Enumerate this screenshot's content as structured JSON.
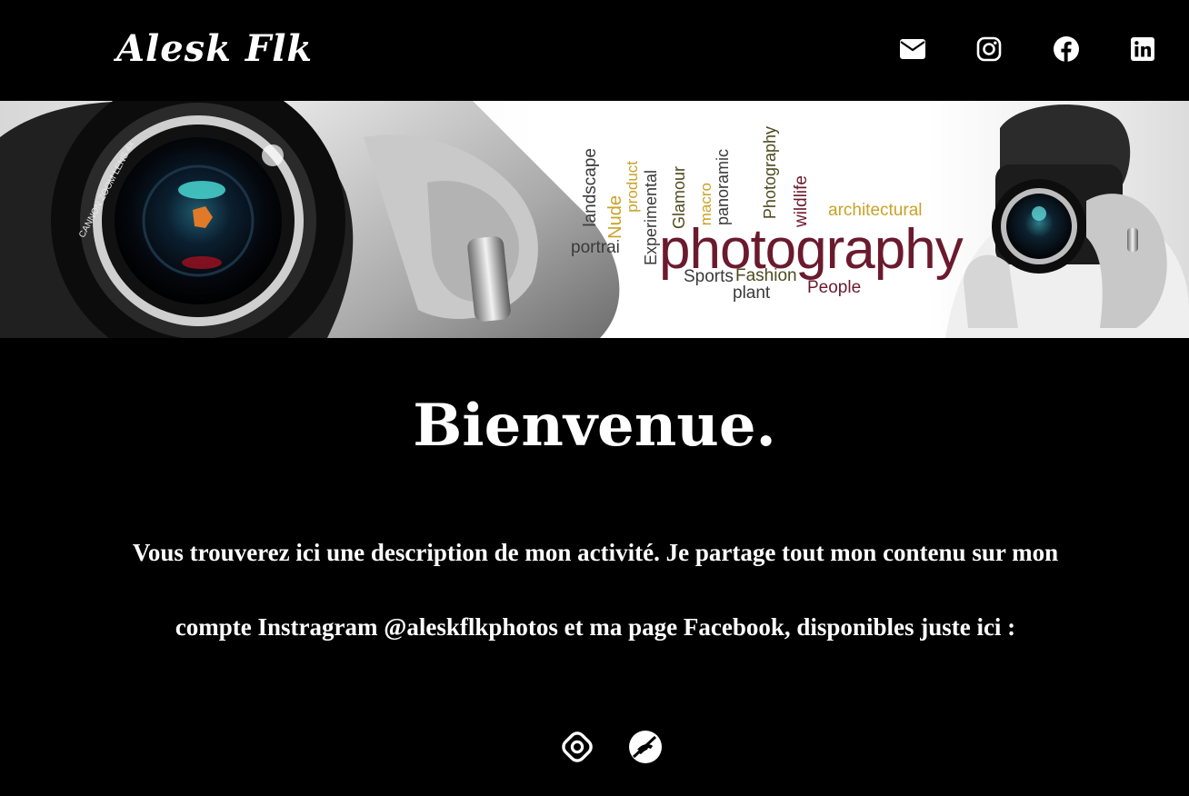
{
  "header": {
    "logo_text": "Alesk Flk",
    "social_icons": [
      "envelope-icon",
      "instagram-icon",
      "facebook-icon",
      "linkedin-icon"
    ]
  },
  "banner": {
    "lens_text": "CANNON ZOOM LENS 4x",
    "words": {
      "photography": "photography",
      "landscape": "landscape",
      "nude": "Nude",
      "product": "product",
      "experimental": "Experimental",
      "glamour": "Glamour",
      "macro": "macro",
      "panoramic": "panoramic",
      "photography_small": "Photography",
      "wildlife": "wildlife",
      "architectural": "architectural",
      "portrai": "portrai",
      "sports": "Sports",
      "fashion": "Fashion",
      "plant": "plant",
      "people": "People"
    }
  },
  "main": {
    "title": "Bienvenue.",
    "paragraph": "Vous trouverez ici une description de mon activité. Je partage tout mon contenu sur mon compte Instragram @aleskflkphotos et ma page Facebook, disponibles juste ici :",
    "link_icons": [
      "target-icon",
      "no-phone-icon"
    ]
  },
  "colors": {
    "background": "#000000",
    "text": "#ffffff",
    "word_dark_red": "#6b1a2e",
    "word_gold": "#c9a227",
    "word_olive": "#4d4a1f",
    "word_gray": "#3a3a3a"
  }
}
